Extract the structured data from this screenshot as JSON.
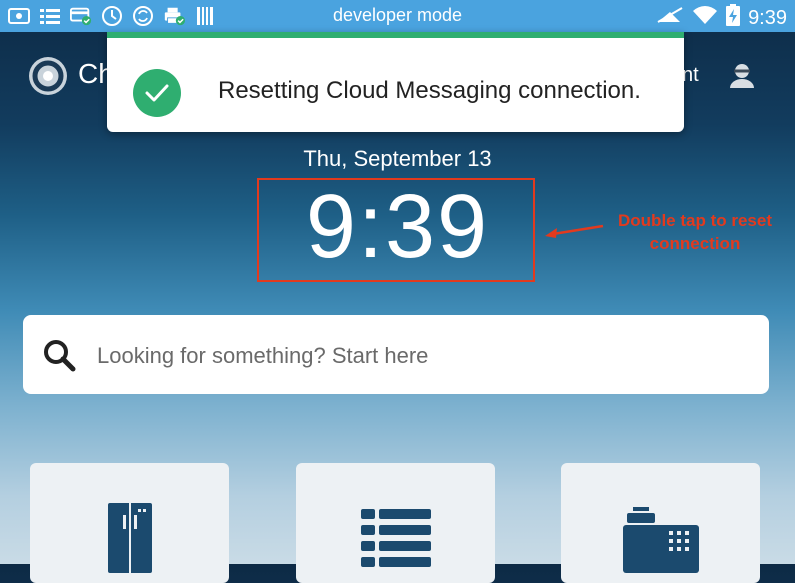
{
  "status_bar": {
    "title": "developer mode",
    "time": "9:39",
    "left_icons": [
      "screen-icon",
      "list-icon",
      "card-check-icon",
      "clock-icon",
      "sync-icon",
      "printer-check-icon",
      "barcode-icon"
    ],
    "right_icons": [
      "signal-icon",
      "wifi-icon",
      "battery-charging-icon"
    ],
    "background": "#4aa3df"
  },
  "header": {
    "app_name_visible": "Ch",
    "user_name_visible": "ynt"
  },
  "toast": {
    "message": "Resetting Cloud Messaging connection.",
    "accent": "#2fae70"
  },
  "clock": {
    "date": "Thu, September 13",
    "time": "9:39"
  },
  "annotation": {
    "line1": "Double tap to reset",
    "line2": "connection",
    "color": "#e23a1e"
  },
  "search": {
    "placeholder": "Looking for something? Start here"
  },
  "tiles": [
    {
      "icon": "refrigerator-icon"
    },
    {
      "icon": "list-icon"
    },
    {
      "icon": "register-icon"
    }
  ]
}
